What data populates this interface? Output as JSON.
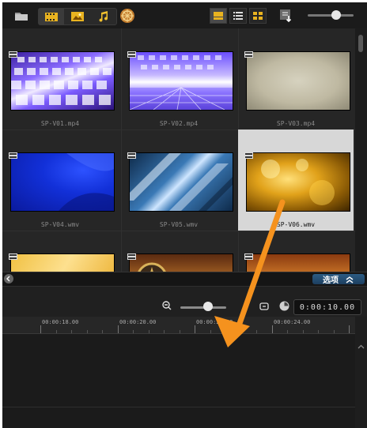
{
  "toolbar": {
    "icons": [
      "folder-icon",
      "video-filter-icon",
      "image-filter-icon",
      "audio-filter-icon",
      "effects-icon",
      "list-view-large-icon",
      "list-view-icon",
      "thumbnail-view-icon",
      "sort-icon"
    ],
    "thumbnail_size_level": 0.62
  },
  "library": {
    "items": [
      {
        "name": "SP-V01.mp4"
      },
      {
        "name": "SP-V02.mp4"
      },
      {
        "name": "SP-V03.mp4"
      },
      {
        "name": "SP-V04.wmv"
      },
      {
        "name": "SP-V05.wmv"
      },
      {
        "name": "SP-V06.wmv",
        "selected": true
      }
    ]
  },
  "divider": {
    "options_label": "选项"
  },
  "timeline": {
    "timecode": "0:00:10.00",
    "zoom_level": 0.6,
    "ruler": [
      "00:00:18.00",
      "00:00:20.00",
      "00:00:22.00",
      "00:00:24.00"
    ]
  },
  "colors": {
    "accent_arrow": "#f5921e",
    "options_blue": "#2c5c84",
    "selected_cell": "#d7d7d7"
  }
}
